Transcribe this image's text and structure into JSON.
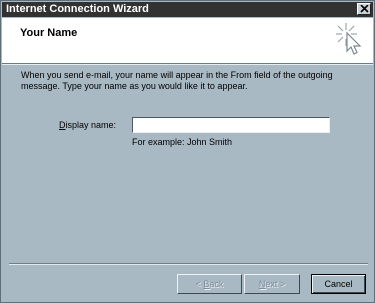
{
  "window": {
    "title": "Internet Connection Wizard"
  },
  "header": {
    "title": "Your Name",
    "icon": "wizard-wand-icon"
  },
  "body": {
    "instructions": "When you send e-mail, your name will appear in the From field of the outgoing message. Type your name as you would like it to appear.",
    "display_name_label": "Display name:",
    "display_name_value": "",
    "example_text": "For example: John Smith"
  },
  "buttons": {
    "back_arrow": "< ",
    "back_key": "B",
    "back_rest": "ack",
    "next_key": "N",
    "next_rest": "ext >",
    "cancel": "Cancel"
  },
  "colors": {
    "dialog_bg": "#a9b9c3",
    "titlebar_bg": "#323232",
    "header_bg": "#ffffff"
  }
}
